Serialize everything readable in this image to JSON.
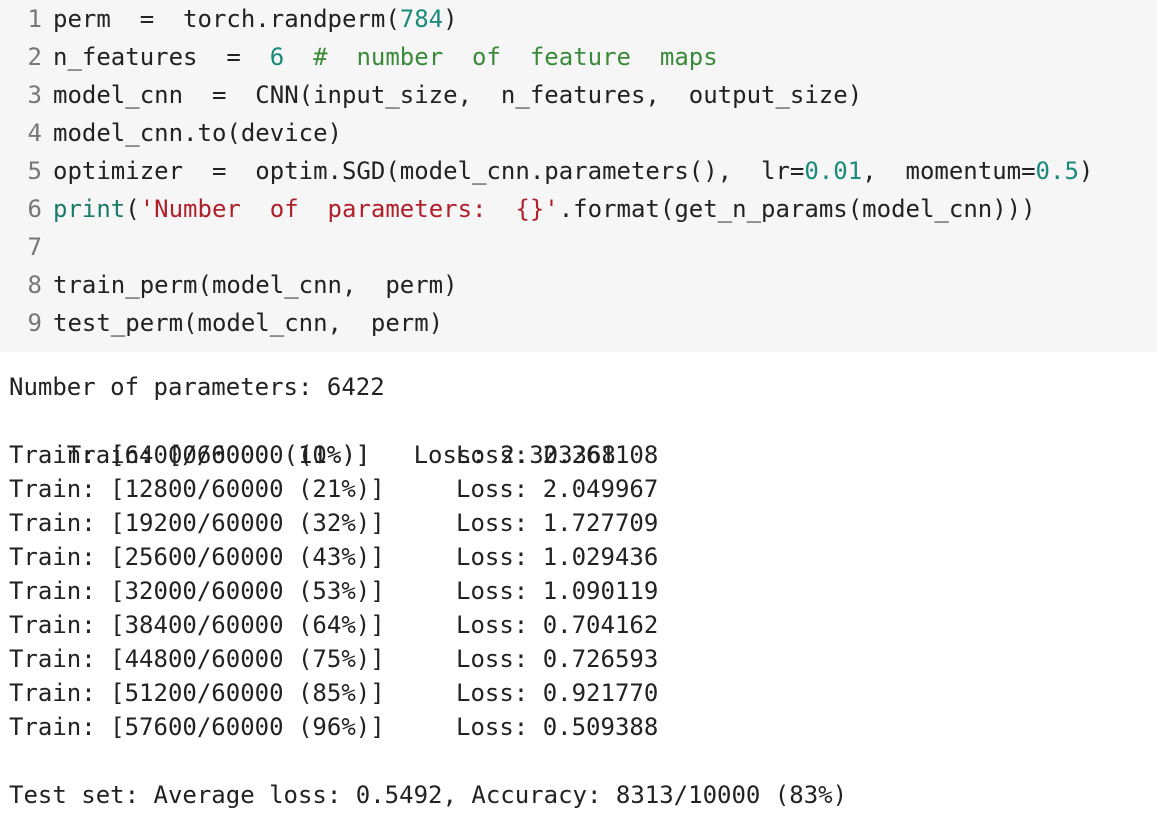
{
  "colors": {
    "code_background": "#f6f6f6",
    "line_number": "#777777",
    "text": "#222222",
    "number": "#1a8a7a",
    "comment": "#3a8a3a",
    "string": "#b0202a",
    "builtin": "#1a7a6a"
  },
  "code": {
    "lines": [
      {
        "num": "1",
        "tokens": [
          {
            "t": "perm  =  torch.randperm(",
            "c": "default"
          },
          {
            "t": "784",
            "c": "number"
          },
          {
            "t": ")",
            "c": "default"
          }
        ]
      },
      {
        "num": "2",
        "tokens": [
          {
            "t": "n_features  =  ",
            "c": "default"
          },
          {
            "t": "6",
            "c": "number"
          },
          {
            "t": "  ",
            "c": "default"
          },
          {
            "t": "#  number  of  feature  maps",
            "c": "comment"
          }
        ]
      },
      {
        "num": "3",
        "tokens": [
          {
            "t": "model_cnn  =  CNN(input_size,  n_features,  output_size)",
            "c": "default"
          }
        ]
      },
      {
        "num": "4",
        "tokens": [
          {
            "t": "model_cnn.to(device)",
            "c": "default"
          }
        ]
      },
      {
        "num": "5",
        "tokens": [
          {
            "t": "optimizer  =  optim.SGD(model_cnn.parameters(),  lr=",
            "c": "default"
          },
          {
            "t": "0.01",
            "c": "number"
          },
          {
            "t": ",  momentum=",
            "c": "default"
          },
          {
            "t": "0.5",
            "c": "number"
          },
          {
            "t": ")",
            "c": "default"
          }
        ]
      },
      {
        "num": "6",
        "tokens": [
          {
            "t": "print",
            "c": "builtin"
          },
          {
            "t": "(",
            "c": "default"
          },
          {
            "t": "'Number  of  parameters:  {}'",
            "c": "string"
          },
          {
            "t": ".format(get_n_params(model_cnn)))",
            "c": "default"
          }
        ]
      },
      {
        "num": "7",
        "tokens": []
      },
      {
        "num": "8",
        "tokens": [
          {
            "t": "train_perm(model_cnn,  perm)",
            "c": "default"
          }
        ]
      },
      {
        "num": "9",
        "tokens": [
          {
            "t": "test_perm(model_cnn,  perm)",
            "c": "default"
          }
        ]
      }
    ]
  },
  "output": {
    "params_line": "Number of parameters: 6422",
    "first_train": {
      "progress": "Train: [0/60000 (0%)]",
      "loss": "Loss: 2.303368"
    },
    "train_lines": [
      {
        "progress": "Train: [6400/60000 (11%)]",
        "loss": "Loss: 2.261108"
      },
      {
        "progress": "Train: [12800/60000 (21%)]",
        "loss": "Loss: 2.049967"
      },
      {
        "progress": "Train: [19200/60000 (32%)]",
        "loss": "Loss: 1.727709"
      },
      {
        "progress": "Train: [25600/60000 (43%)]",
        "loss": "Loss: 1.029436"
      },
      {
        "progress": "Train: [32000/60000 (53%)]",
        "loss": "Loss: 1.090119"
      },
      {
        "progress": "Train: [38400/60000 (64%)]",
        "loss": "Loss: 0.704162"
      },
      {
        "progress": "Train: [44800/60000 (75%)]",
        "loss": "Loss: 0.726593"
      },
      {
        "progress": "Train: [51200/60000 (85%)]",
        "loss": "Loss: 0.921770"
      },
      {
        "progress": "Train: [57600/60000 (96%)]",
        "loss": "Loss: 0.509388"
      }
    ],
    "test_line": "Test set: Average loss: 0.5492, Accuracy: 8313/10000 (83%)"
  }
}
